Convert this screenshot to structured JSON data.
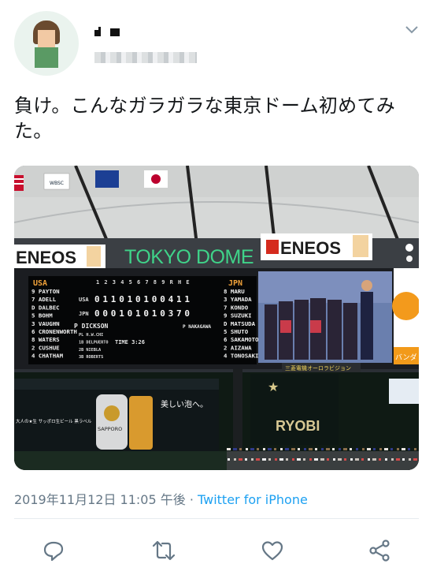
{
  "tweet": {
    "text": "負け。こんなガラガラな東京ドーム初めてみた。",
    "timestamp": "2019年11月12日 11:05 午後",
    "separator": " · ",
    "source": "Twitter for iPhone"
  },
  "photo": {
    "signs": {
      "wbsc": "WBSC",
      "eneos": "ENEOS",
      "tokyo_dome": "TOKYO DOME",
      "ryobi": "RYOBI",
      "mitsubishi": "三菱電機オーロラビジョン",
      "beer_copy": "美しい泡へ。",
      "sapporo": "SAPPORO",
      "beer_side": "大人の★生 サッポロ生ビール 黒ラベル",
      "banda": "バンダ"
    },
    "scoreboard": {
      "away_team": "USA",
      "home_team": "JPN",
      "innings_header": [
        "1",
        "2",
        "3",
        "4",
        "5",
        "6",
        "7",
        "8",
        "9",
        "R",
        "H",
        "E"
      ],
      "away_line": [
        "0",
        "1",
        "1",
        "0",
        "1",
        "0",
        "1",
        "0",
        "0",
        "4",
        "1",
        "1"
      ],
      "home_line": [
        "0",
        "0",
        "0",
        "1",
        "0",
        "1",
        "0",
        "1",
        "0",
        "3",
        "7",
        "0"
      ],
      "away_lineup": [
        "9 PAYTON",
        "7 ADELL",
        "D DALBEC",
        "5 BOHM",
        "3 VAUGHN",
        "6 CRONENWORTH",
        "8 WATERS",
        "2 CUSHUE",
        "4 CHATHAM"
      ],
      "home_lineup": [
        "8 MARU",
        "3 YAMADA",
        "7 KONDO",
        "9 SUZUKI",
        "D MATSUDA",
        "5 SHUTO",
        "6 SAKAMOTO",
        "2 AIZAWA",
        "4 TONOSAKI"
      ],
      "away_pitcher": "P DICKSON",
      "home_pitcher": "P NAKAGAWA",
      "umpires": [
        "PL H.W.CHI",
        "1B DELPUERTO",
        "2B NIEBLA",
        "3B ROBERTS"
      ],
      "time": "TIME 3:26"
    }
  },
  "actions": [
    {
      "name": "reply-icon"
    },
    {
      "name": "retweet-icon"
    },
    {
      "name": "like-icon"
    },
    {
      "name": "share-icon"
    }
  ],
  "colors": {
    "accent": "#1da1f2",
    "muted": "#657786",
    "icon": "#657786"
  }
}
